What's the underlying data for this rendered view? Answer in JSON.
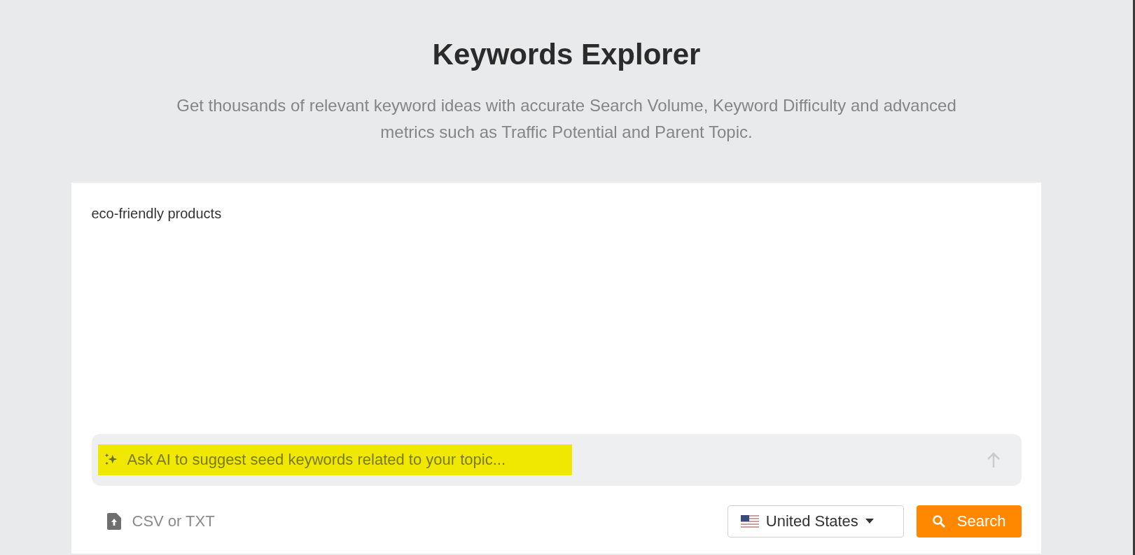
{
  "header": {
    "title": "Keywords Explorer",
    "subtitle": "Get thousands of relevant keyword ideas with accurate Search Volume, Keyword Difficulty and advanced metrics such as Traffic Potential and Parent Topic."
  },
  "keywords_input": {
    "value": "eco-friendly products"
  },
  "ai_prompt": {
    "placeholder": "Ask AI to suggest seed keywords related to your topic...",
    "highlighted": true
  },
  "upload": {
    "label": "CSV or TXT"
  },
  "country_select": {
    "value": "United States"
  },
  "search_button": {
    "label": "Search"
  }
}
